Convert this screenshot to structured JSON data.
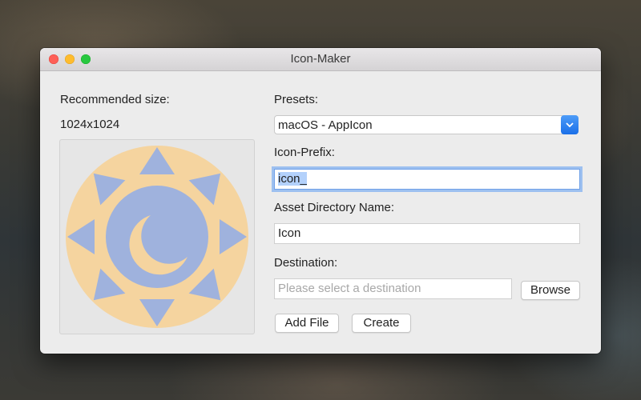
{
  "window": {
    "title": "Icon-Maker"
  },
  "left": {
    "recommended_label": "Recommended size:",
    "recommended_value": "1024x1024",
    "preview_icon": "sun-moon-icon",
    "colors": {
      "sun": "#f5d49f",
      "moon": "#9fb2dd"
    }
  },
  "form": {
    "presets_label": "Presets:",
    "presets_value": "macOS - AppIcon",
    "prefix_label": "Icon-Prefix:",
    "prefix_value": "icon_",
    "asset_label": "Asset Directory Name:",
    "asset_value": "Icon",
    "destination_label": "Destination:",
    "destination_placeholder": "Please select a destination",
    "browse_label": "Browse",
    "add_file_label": "Add File",
    "create_label": "Create"
  }
}
